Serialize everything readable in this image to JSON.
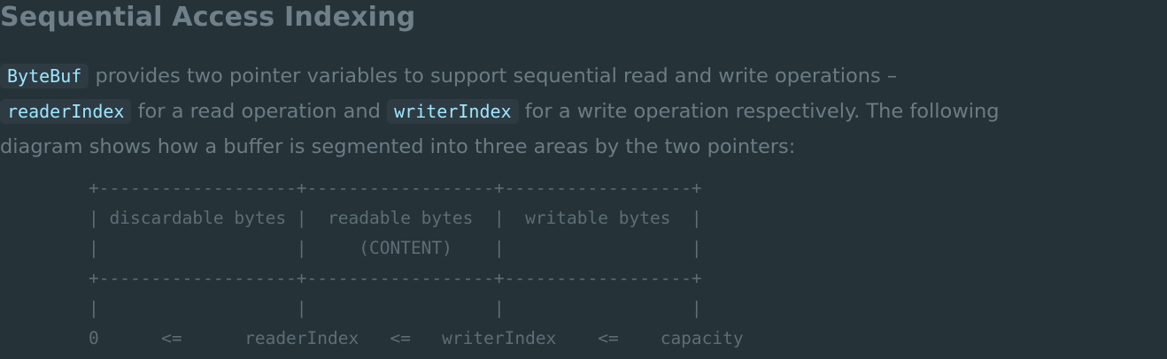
{
  "heading": "Sequential Access Indexing",
  "paragraph": {
    "code_bytebuf": "ByteBuf",
    "text_1": " provides two pointer variables to support sequential read and write operations –",
    "code_readerindex": "readerIndex",
    "text_2": " for a read operation and ",
    "code_writerindex": "writerIndex",
    "text_3": " for a write operation respectively. The following",
    "text_4": "diagram shows how a buffer is segmented into three areas by the two pointers:"
  },
  "diagram": {
    "lines": [
      "+-------------------+------------------+------------------+",
      "| discardable bytes |  readable bytes  |  writable bytes  |",
      "|                   |     (CONTENT)    |                  |",
      "+-------------------+------------------+------------------+",
      "|                   |                  |                  |",
      "0      <=      readerIndex   <=   writerIndex    <=    capacity"
    ]
  }
}
